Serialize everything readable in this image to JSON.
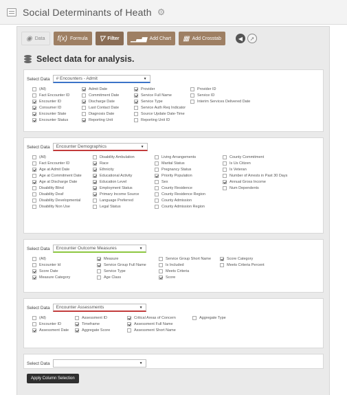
{
  "app": {
    "title": "Social Determinants of Heath"
  },
  "toolbar": {
    "data_label": "Data",
    "formula_label": "Formula",
    "filter_label": "Filter",
    "add_chart_label": "Add Chart",
    "add_crosstab_label": "Add Crosstab"
  },
  "heading": "Select data for analysis.",
  "select_label": "Select Data",
  "apply_label": "Apply Column Selection",
  "colors": {
    "underline_blue": "#3b73c8",
    "underline_red": "#c23b3b",
    "underline_green": "#8cc63f",
    "brown": "#9e7f63"
  },
  "sections": [
    {
      "value": "# Encounters - Admit",
      "underline": "blue",
      "columns": [
        [
          {
            "label": "(All)",
            "checked": false
          },
          {
            "label": "Fact Encounter ID",
            "checked": false
          },
          {
            "label": "Encounter ID",
            "checked": true
          },
          {
            "label": "Consumer ID",
            "checked": true
          },
          {
            "label": "Encounter State",
            "checked": true
          },
          {
            "label": "Encounter Status",
            "checked": true
          }
        ],
        [
          {
            "label": "Admit Date",
            "checked": true
          },
          {
            "label": "Commitment Date",
            "checked": false
          },
          {
            "label": "Discharge Date",
            "checked": true
          },
          {
            "label": "Last Contact Date",
            "checked": false
          },
          {
            "label": "Diagnosis Date",
            "checked": false
          },
          {
            "label": "Reporting Unit",
            "checked": true
          }
        ],
        [
          {
            "label": "Provider",
            "checked": true
          },
          {
            "label": "Service Full Name",
            "checked": true
          },
          {
            "label": "Service Type",
            "checked": true
          },
          {
            "label": "Service Auth Req Indicator",
            "checked": false
          },
          {
            "label": "Source Update Date-Time",
            "checked": false
          },
          {
            "label": "Reporting Unit ID",
            "checked": false
          }
        ],
        [
          {
            "label": "Provider ID",
            "checked": false
          },
          {
            "label": "Service ID",
            "checked": false
          },
          {
            "label": "Interim Services Delivered Date",
            "checked": false
          }
        ]
      ]
    },
    {
      "value": "Encounter Demographics",
      "underline": "red",
      "columns": [
        [
          {
            "label": "(All)",
            "checked": false
          },
          {
            "label": "Fact Encounter ID",
            "checked": false
          },
          {
            "label": "Age at Admit Date",
            "checked": true
          },
          {
            "label": "Age at Commitment Date",
            "checked": false
          },
          {
            "label": "Age at Discharge Date",
            "checked": true
          },
          {
            "label": "Disability Blind",
            "checked": false
          },
          {
            "label": "Disability Deaf",
            "checked": false
          },
          {
            "label": "Disability Developmental",
            "checked": false
          },
          {
            "label": "Disability Non Use",
            "checked": false
          }
        ],
        [
          {
            "label": "Disability Ambulation",
            "checked": false
          },
          {
            "label": "Race",
            "checked": true
          },
          {
            "label": "Ethnicity",
            "checked": true
          },
          {
            "label": "Educational Activity",
            "checked": true
          },
          {
            "label": "Education Level",
            "checked": true
          },
          {
            "label": "Employment Status",
            "checked": true
          },
          {
            "label": "Primary Income Source",
            "checked": true
          },
          {
            "label": "Language Preferred",
            "checked": false
          },
          {
            "label": "Legal Status",
            "checked": false
          }
        ],
        [
          {
            "label": "Living Arrangements",
            "checked": false
          },
          {
            "label": "Marital Status",
            "checked": false
          },
          {
            "label": "Pregnancy Status",
            "checked": false
          },
          {
            "label": "Priority Population",
            "checked": true
          },
          {
            "label": "Sex",
            "checked": false
          },
          {
            "label": "County Residence",
            "checked": false
          },
          {
            "label": "County Residence Region",
            "checked": false
          },
          {
            "label": "County Admission",
            "checked": false
          },
          {
            "label": "County Admission Region",
            "checked": false
          }
        ],
        [
          {
            "label": "County Commitment",
            "checked": false
          },
          {
            "label": "Is Us Citizen",
            "checked": false
          },
          {
            "label": "Is Veteran",
            "checked": false
          },
          {
            "label": "Number of Arrests in Past 30 Days",
            "checked": false
          },
          {
            "label": "Annual Gross Income",
            "checked": true
          },
          {
            "label": "Num Dependents",
            "checked": false
          }
        ]
      ]
    },
    {
      "value": "Encounter Outcome Measures",
      "underline": "green",
      "columns": [
        [
          {
            "label": "(All)",
            "checked": false
          },
          {
            "label": "Encounter Id",
            "checked": false
          },
          {
            "label": "Score Date",
            "checked": true
          },
          {
            "label": "Measure Category",
            "checked": true
          }
        ],
        [
          {
            "label": "Measure",
            "checked": true
          },
          {
            "label": "Service Group Full Name",
            "checked": true
          },
          {
            "label": "Service Type",
            "checked": false
          },
          {
            "label": "Age Class",
            "checked": false
          }
        ],
        [
          {
            "label": "Service Group Short Name",
            "checked": false
          },
          {
            "label": "Is Included",
            "checked": false
          },
          {
            "label": "Meets Criteria",
            "checked": false
          },
          {
            "label": "Score",
            "checked": true
          }
        ],
        [
          {
            "label": "Score Category",
            "checked": true
          },
          {
            "label": "Meets Criteria Percent",
            "checked": false
          }
        ]
      ]
    },
    {
      "value": "Encounter Assessments",
      "underline": "red",
      "columns": [
        [
          {
            "label": "(All)",
            "checked": false
          },
          {
            "label": "Encounter ID",
            "checked": false
          },
          {
            "label": "Assessment Date",
            "checked": true
          }
        ],
        [
          {
            "label": "Assessment ID",
            "checked": false
          },
          {
            "label": "Timeframe",
            "checked": true
          },
          {
            "label": "Aggregate Score",
            "checked": true
          }
        ],
        [
          {
            "label": "Critical Areas of Concern",
            "checked": true
          },
          {
            "label": "Assessment Full Name",
            "checked": true
          },
          {
            "label": "Assessment Short Name",
            "checked": false
          }
        ],
        [
          {
            "label": "Aggregate Type",
            "checked": false
          }
        ]
      ]
    },
    {
      "value": "",
      "underline": "none",
      "columns": []
    }
  ]
}
